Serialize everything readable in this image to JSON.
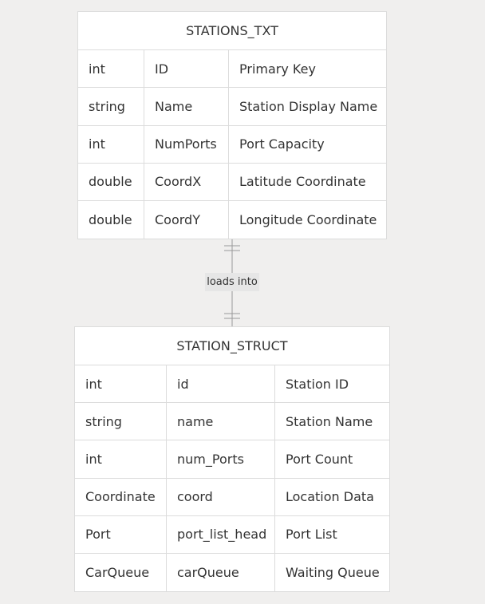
{
  "entities": [
    {
      "name": "STATIONS_TXT",
      "rows": [
        {
          "type": "int",
          "field": "ID",
          "desc": "Primary Key"
        },
        {
          "type": "string",
          "field": "Name",
          "desc": "Station Display Name"
        },
        {
          "type": "int",
          "field": "NumPorts",
          "desc": "Port Capacity"
        },
        {
          "type": "double",
          "field": "CoordX",
          "desc": "Latitude Coordinate"
        },
        {
          "type": "double",
          "field": "CoordY",
          "desc": "Longitude Coordinate"
        }
      ]
    },
    {
      "name": "STATION_STRUCT",
      "rows": [
        {
          "type": "int",
          "field": "id",
          "desc": "Station ID"
        },
        {
          "type": "string",
          "field": "name",
          "desc": "Station Name"
        },
        {
          "type": "int",
          "field": "num_Ports",
          "desc": "Port Count"
        },
        {
          "type": "Coordinate",
          "field": "coord",
          "desc": "Location Data"
        },
        {
          "type": "Port",
          "field": "port_list_head",
          "desc": "Port List"
        },
        {
          "type": "CarQueue",
          "field": "carQueue",
          "desc": "Waiting Queue"
        }
      ]
    }
  ],
  "relationship": {
    "label": "loads into",
    "from": "STATIONS_TXT",
    "to": "STATION_STRUCT",
    "cardinality_from": "exactly-one",
    "cardinality_to": "exactly-one"
  },
  "colors": {
    "background": "#f0efee",
    "entity_fill": "#ffffff",
    "border": "#dcdcdc",
    "line": "#999999",
    "label_bg": "#e6e6e6",
    "text": "#333333"
  }
}
